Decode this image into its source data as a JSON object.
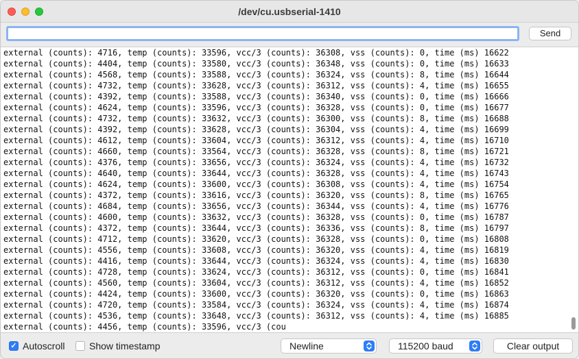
{
  "window": {
    "title": "/dev/cu.usbserial-1410"
  },
  "input": {
    "value": "",
    "send_label": "Send"
  },
  "log_lines": [
    "external (counts): 4716, temp (counts): 33596, vcc/3 (counts): 36308, vss (counts): 0, time (ms) 16622",
    "external (counts): 4404, temp (counts): 33580, vcc/3 (counts): 36348, vss (counts): 0, time (ms) 16633",
    "external (counts): 4568, temp (counts): 33588, vcc/3 (counts): 36324, vss (counts): 8, time (ms) 16644",
    "external (counts): 4732, temp (counts): 33628, vcc/3 (counts): 36312, vss (counts): 4, time (ms) 16655",
    "external (counts): 4392, temp (counts): 33588, vcc/3 (counts): 36340, vss (counts): 0, time (ms) 16666",
    "external (counts): 4624, temp (counts): 33596, vcc/3 (counts): 36328, vss (counts): 0, time (ms) 16677",
    "external (counts): 4732, temp (counts): 33632, vcc/3 (counts): 36300, vss (counts): 8, time (ms) 16688",
    "external (counts): 4392, temp (counts): 33628, vcc/3 (counts): 36304, vss (counts): 4, time (ms) 16699",
    "external (counts): 4612, temp (counts): 33604, vcc/3 (counts): 36312, vss (counts): 4, time (ms) 16710",
    "external (counts): 4660, temp (counts): 33564, vcc/3 (counts): 36328, vss (counts): 8, time (ms) 16721",
    "external (counts): 4376, temp (counts): 33656, vcc/3 (counts): 36324, vss (counts): 4, time (ms) 16732",
    "external (counts): 4640, temp (counts): 33644, vcc/3 (counts): 36328, vss (counts): 4, time (ms) 16743",
    "external (counts): 4624, temp (counts): 33600, vcc/3 (counts): 36308, vss (counts): 4, time (ms) 16754",
    "external (counts): 4372, temp (counts): 33616, vcc/3 (counts): 36320, vss (counts): 8, time (ms) 16765",
    "external (counts): 4684, temp (counts): 33656, vcc/3 (counts): 36344, vss (counts): 4, time (ms) 16776",
    "external (counts): 4600, temp (counts): 33632, vcc/3 (counts): 36328, vss (counts): 0, time (ms) 16787",
    "external (counts): 4372, temp (counts): 33644, vcc/3 (counts): 36336, vss (counts): 8, time (ms) 16797",
    "external (counts): 4712, temp (counts): 33620, vcc/3 (counts): 36328, vss (counts): 0, time (ms) 16808",
    "external (counts): 4556, temp (counts): 33608, vcc/3 (counts): 36320, vss (counts): 4, time (ms) 16819",
    "external (counts): 4416, temp (counts): 33644, vcc/3 (counts): 36324, vss (counts): 4, time (ms) 16830",
    "external (counts): 4728, temp (counts): 33624, vcc/3 (counts): 36312, vss (counts): 0, time (ms) 16841",
    "external (counts): 4560, temp (counts): 33604, vcc/3 (counts): 36312, vss (counts): 4, time (ms) 16852",
    "external (counts): 4424, temp (counts): 33600, vcc/3 (counts): 36320, vss (counts): 0, time (ms) 16863",
    "external (counts): 4720, temp (counts): 33584, vcc/3 (counts): 36324, vss (counts): 4, time (ms) 16874",
    "external (counts): 4536, temp (counts): 33648, vcc/3 (counts): 36312, vss (counts): 4, time (ms) 16885",
    "external (counts): 4456, temp (counts): 33596, vcc/3 (cou"
  ],
  "footer": {
    "autoscroll_label": "Autoscroll",
    "autoscroll_checked": true,
    "timestamp_label": "Show timestamp",
    "timestamp_checked": false,
    "line_ending": "Newline",
    "baud_rate": "115200 baud",
    "clear_label": "Clear output"
  },
  "icons": {
    "close": "close-traffic-light-icon",
    "minimize": "minimize-traffic-light-icon",
    "maximize": "maximize-traffic-light-icon",
    "select_arrows": "updown-chevron-icon",
    "checkmark": "checkmark-icon"
  },
  "colors": {
    "accent": "#2f7cf6",
    "close": "#fe5f57",
    "minimize": "#febc2e",
    "maximize": "#28c840"
  }
}
